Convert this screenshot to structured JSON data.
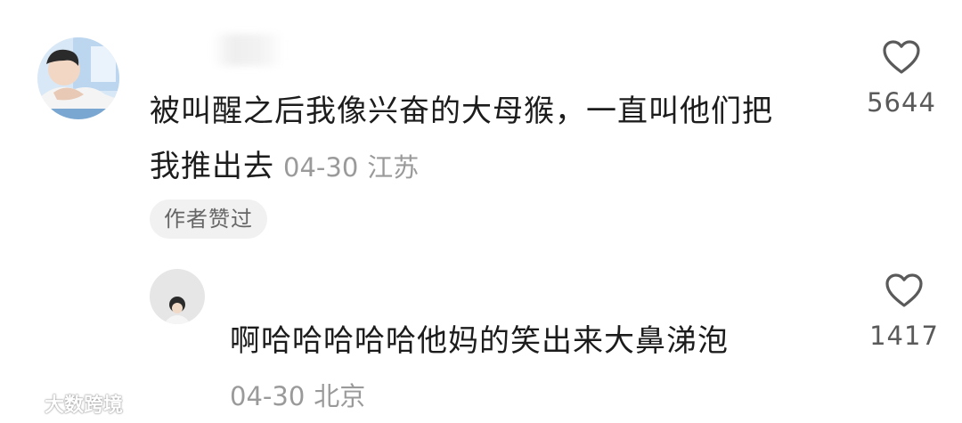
{
  "comment": {
    "text_line1": "被叫醒之后我像兴奋的大母猴，一直叫他们把",
    "text_line2": "我推出去",
    "date": "04-30",
    "location": "江苏",
    "author_liked_badge": "作者赞过",
    "likes": "5644"
  },
  "reply": {
    "text": "啊哈哈哈哈哈他妈的笑出来大鼻涕泡",
    "date": "04-30",
    "location": "北京",
    "likes": "1417"
  },
  "watermark": {
    "text": "大数跨境"
  },
  "icons": {
    "like": "heart-outline-icon"
  }
}
